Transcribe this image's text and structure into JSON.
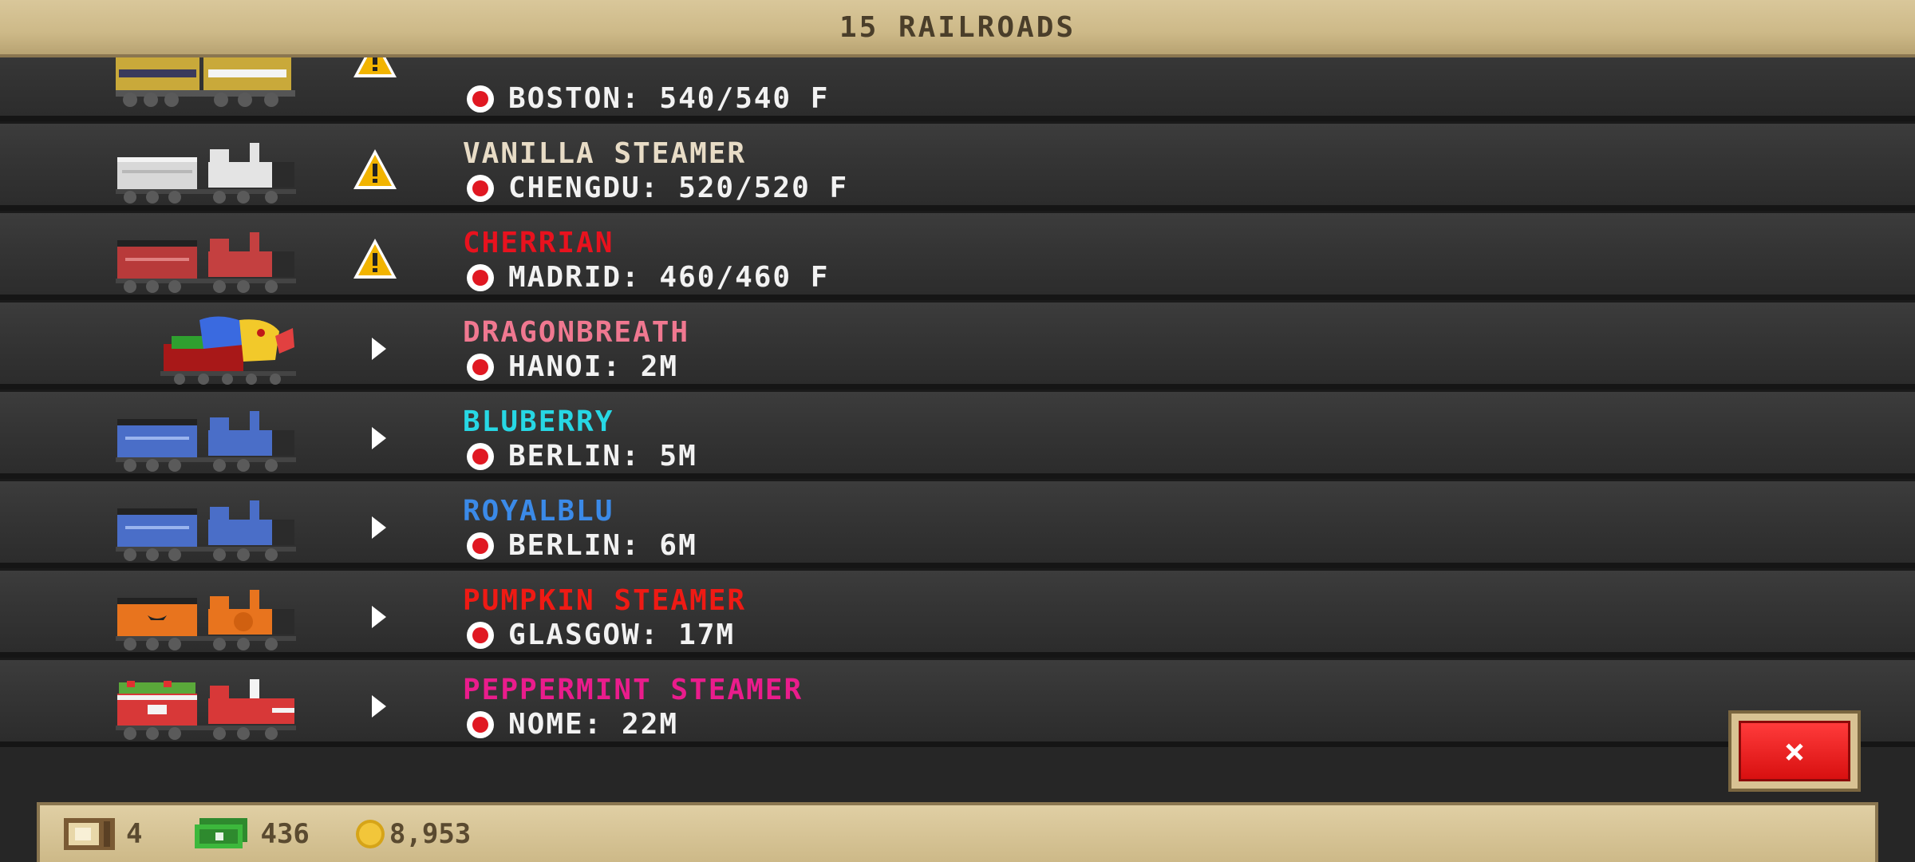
{
  "header": {
    "title": "15 RAILROADS"
  },
  "railroads": [
    {
      "name": "",
      "name_color": "#d9d9d9",
      "destination": "BOSTON: 540/540 F",
      "status": "warning-icon"
    },
    {
      "name": "VANILLA STEAMER",
      "name_color": "#e8dcc6",
      "destination": "CHENGDU: 520/520 F",
      "status": "warning-icon"
    },
    {
      "name": "CHERRIAN",
      "name_color": "#e8121e",
      "destination": "MADRID: 460/460 F",
      "status": "warning-icon"
    },
    {
      "name": "DRAGONBREATH",
      "name_color": "#f07890",
      "destination": "HANOI: 2M",
      "status": "play-icon"
    },
    {
      "name": "BLUBERRY",
      "name_color": "#27d7e4",
      "destination": "BERLIN: 5M",
      "status": "play-icon"
    },
    {
      "name": "ROYALBLU",
      "name_color": "#3b8ae8",
      "destination": "BERLIN: 6M",
      "status": "play-icon"
    },
    {
      "name": "PUMPKIN STEAMER",
      "name_color": "#ef1a14",
      "destination": "GLASGOW: 17M",
      "status": "play-icon"
    },
    {
      "name": "PEPPERMINT STEAMER",
      "name_color": "#ea1c8c",
      "destination": "NOME: 22M",
      "status": "play-icon"
    }
  ],
  "close_button": {
    "label": "×"
  },
  "footer": {
    "crates": "4",
    "cash": "436",
    "coins": "8,953"
  }
}
